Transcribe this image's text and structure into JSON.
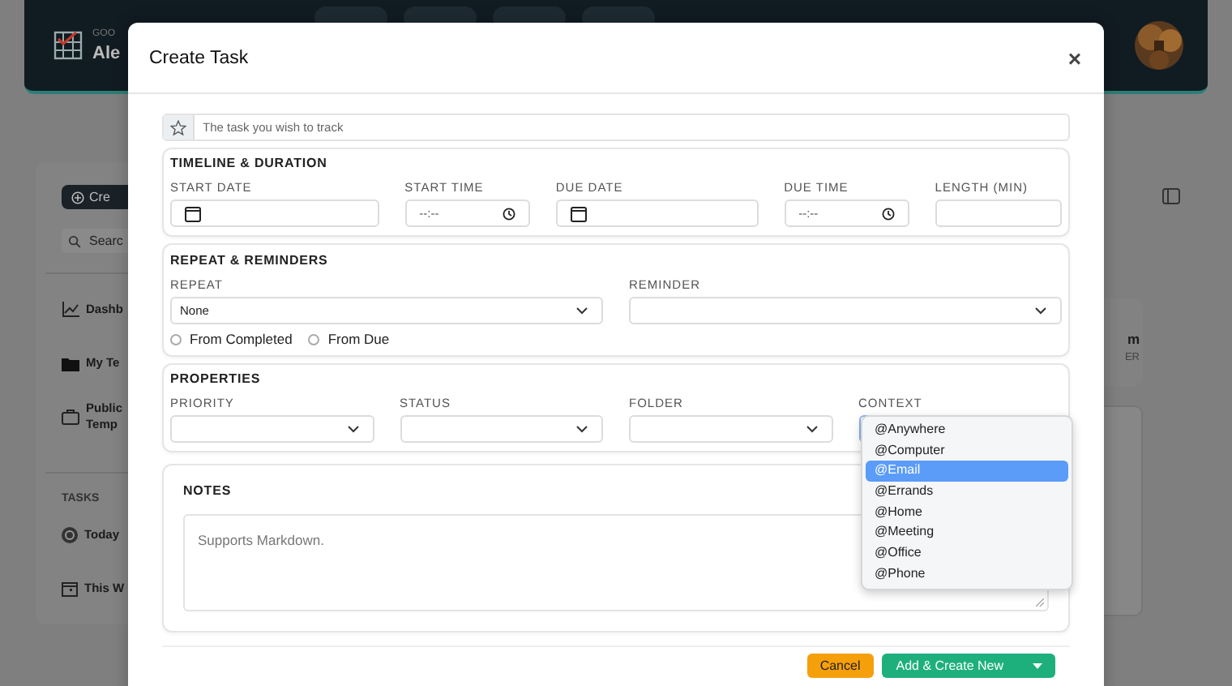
{
  "background": {
    "header": {
      "greeting": "GOO",
      "name": "Ale"
    },
    "sidebar": {
      "create_button": "Cre",
      "search_placeholder": "Searc",
      "items": [
        {
          "label": "Dashb",
          "kind": "chart"
        },
        {
          "label": "My Te",
          "kind": "folder"
        },
        {
          "label": "Public\nTemp",
          "kind": "box"
        }
      ],
      "section_heading": "TASKS",
      "task_items": [
        {
          "label": "Today",
          "kind": "target"
        },
        {
          "label": "This W",
          "kind": "calendar"
        }
      ]
    },
    "right_card": {
      "title": "m",
      "subtitle": "ER"
    }
  },
  "modal": {
    "title": "Create Task",
    "close": "×",
    "task_field": {
      "placeholder": "The task you wish to track"
    },
    "sections": [
      {
        "kind": "timeline",
        "heading": "TIMELINE & DURATION",
        "fields": [
          {
            "label": "START DATE",
            "kind": "date"
          },
          {
            "label": "START TIME",
            "kind": "time",
            "placeholder": "--:--"
          },
          {
            "label": "DUE DATE",
            "kind": "date"
          },
          {
            "label": "DUE TIME",
            "kind": "time",
            "placeholder": "--:--"
          },
          {
            "label": "LENGTH (MIN)",
            "kind": "text"
          }
        ]
      },
      {
        "kind": "repeat",
        "heading": "REPEAT & REMINDERS",
        "fields": [
          {
            "label": "REPEAT",
            "kind": "select",
            "value": "None"
          },
          {
            "label": "REMINDER",
            "kind": "select"
          }
        ],
        "radios": [
          {
            "label": "From Completed",
            "checked": false
          },
          {
            "label": "From Due",
            "checked": false
          }
        ]
      },
      {
        "kind": "properties",
        "heading": "PROPERTIES",
        "fields": [
          {
            "label": "PRIORITY",
            "kind": "select"
          },
          {
            "label": "STATUS",
            "kind": "select"
          },
          {
            "label": "FOLDER",
            "kind": "select"
          },
          {
            "label": "CONTEXT",
            "kind": "select",
            "open": true,
            "options": [
              {
                "label": "@Anywhere",
                "selected": false
              },
              {
                "label": "@Computer",
                "selected": false
              },
              {
                "label": "@Email",
                "selected": true
              },
              {
                "label": "@Errands",
                "selected": false
              },
              {
                "label": "@Home",
                "selected": false
              },
              {
                "label": "@Meeting",
                "selected": false
              },
              {
                "label": "@Office",
                "selected": false
              },
              {
                "label": "@Phone",
                "selected": false
              }
            ]
          }
        ]
      }
    ],
    "notes": {
      "heading": "NOTES",
      "placeholder": "Supports Markdown."
    },
    "buttons": {
      "cancel": "Cancel",
      "primary": "Add & Create New"
    }
  }
}
